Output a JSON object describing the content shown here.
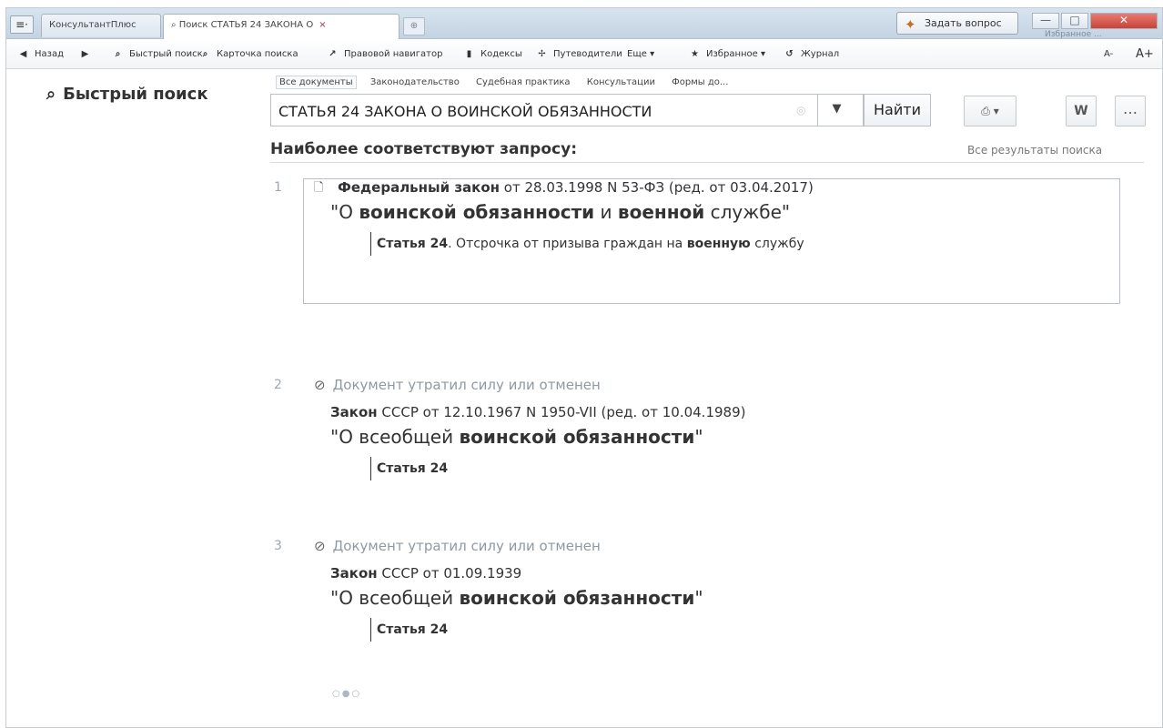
{
  "window": {
    "menu_symbol": "≡·",
    "tabs": [
      {
        "label": "КонсультантПлюс"
      },
      {
        "label": "Поиск СТАТЬЯ 24 ЗАКОНА О",
        "close": "×"
      }
    ],
    "new_tab_symbol": "⊕",
    "ask_question": "Задать вопрос",
    "controls": {
      "min": "—",
      "max": "□",
      "close": "✕"
    },
    "top_right_link": "Избранное ..."
  },
  "toolbar": {
    "back": "Назад",
    "forward": "",
    "quick_search": "Быстрый поиск",
    "search_card": "Карточка поиска",
    "legal_navigator": "Правовой навигатор",
    "codes": "Кодексы",
    "guides": "Путеводители",
    "more": "Еще ▾",
    "favorites": "Избранное ▾",
    "journal": "Журнал",
    "font_minus": "A-",
    "font_plus": "A+"
  },
  "search": {
    "section_title": "Быстрый поиск",
    "filters": [
      {
        "label": "Все документы",
        "active": true
      },
      {
        "label": "Законодательство",
        "active": false
      },
      {
        "label": "Судебная практика",
        "active": false
      },
      {
        "label": "Консультации",
        "active": false
      },
      {
        "label": "Формы до...",
        "active": false
      }
    ],
    "query": "СТАТЬЯ 24 ЗАКОНА О ВОИНСКОЙ ОБЯЗАННОСТИ",
    "find_button": "Найти",
    "print_label": "▾",
    "word_label": "W",
    "more_label": "…"
  },
  "results": {
    "title": "Наиболее соответствуют запросу:",
    "all_results": "Все результаты поиска",
    "items": [
      {
        "number": "1",
        "status": "",
        "line1_prefix": "Федеральный закон",
        "line1_rest": " от 28.03.1998 N 53-ФЗ (ред. от 03.04.2017)",
        "line2_part1": "\"О ",
        "line2_bold1": "воинской обязанности",
        "line2_part2": " и ",
        "line2_bold2": "военной",
        "line2_part3": " службе\"",
        "article_bold": "Статья 24",
        "article_rest": ". Отсрочка от призыва граждан на ",
        "article_bold2": "военную",
        "article_rest2": " службу"
      },
      {
        "number": "2",
        "status": "Документ утратил силу или отменен",
        "line1_prefix": "Закон",
        "line1_rest": " СССР от 12.10.1967 N 1950-VII (ред. от 10.04.1989)",
        "line2_part1": "\"О всеобщей ",
        "line2_bold1": "воинской обязанности",
        "line2_part2": "\"",
        "article_bold": "Статья 24"
      },
      {
        "number": "3",
        "status": "Документ утратил силу или отменен",
        "line1_prefix": "Закон",
        "line1_rest": " СССР от 01.09.1939",
        "line2_part1": "\"О всеобщей ",
        "line2_bold1": "воинской обязанности",
        "line2_part2": "\"",
        "article_bold": "Статья 24"
      }
    ]
  },
  "pager": {
    "dots": "○●○"
  }
}
